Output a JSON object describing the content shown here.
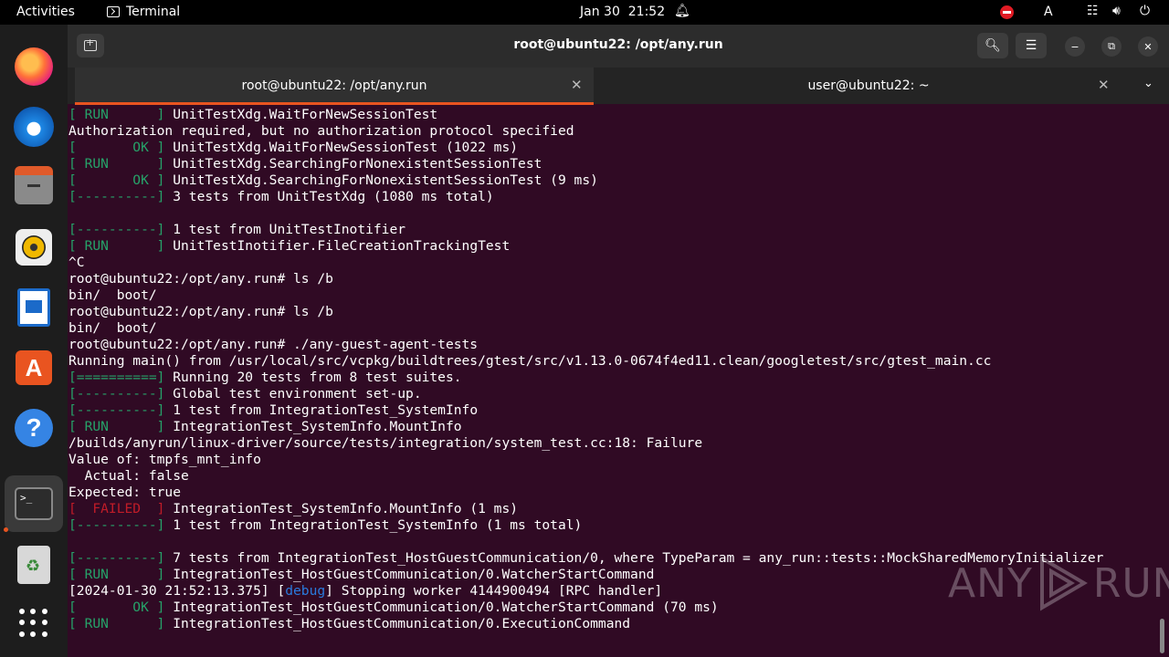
{
  "topbar": {
    "activities": "Activities",
    "app_name": "Terminal",
    "date": "Jan 30",
    "time": "21:52",
    "keyboard_layout": "A"
  },
  "dock": {
    "items": [
      "firefox",
      "thunderbird",
      "files",
      "rhythmbox",
      "libreoffice-writer",
      "app-center",
      "help",
      "terminal",
      "trash",
      "show-apps"
    ]
  },
  "window": {
    "title": "root@ubuntu22: /opt/any.run",
    "tabs": [
      {
        "label": "root@ubuntu22: /opt/any.run",
        "active": true
      },
      {
        "label": "user@ubuntu22: ~",
        "active": false
      }
    ]
  },
  "terminal": {
    "lines": [
      {
        "segs": [
          {
            "t": "[ RUN      ] ",
            "c": "g"
          },
          {
            "t": "UnitTestXdg.WaitForNewSessionTest"
          }
        ]
      },
      {
        "segs": [
          {
            "t": "Authorization required, but no authorization protocol specified"
          }
        ]
      },
      {
        "segs": [
          {
            "t": "[       OK ] ",
            "c": "g"
          },
          {
            "t": "UnitTestXdg.WaitForNewSessionTest (1022 ms)"
          }
        ]
      },
      {
        "segs": [
          {
            "t": "[ RUN      ] ",
            "c": "g"
          },
          {
            "t": "UnitTestXdg.SearchingForNonexistentSessionTest"
          }
        ]
      },
      {
        "segs": [
          {
            "t": "[       OK ] ",
            "c": "g"
          },
          {
            "t": "UnitTestXdg.SearchingForNonexistentSessionTest (9 ms)"
          }
        ]
      },
      {
        "segs": [
          {
            "t": "[----------] ",
            "c": "g"
          },
          {
            "t": "3 tests from UnitTestXdg (1080 ms total)"
          }
        ]
      },
      {
        "segs": []
      },
      {
        "segs": [
          {
            "t": "[----------] ",
            "c": "g"
          },
          {
            "t": "1 test from UnitTestInotifier"
          }
        ]
      },
      {
        "segs": [
          {
            "t": "[ RUN      ] ",
            "c": "g"
          },
          {
            "t": "UnitTestInotifier.FileCreationTrackingTest"
          }
        ]
      },
      {
        "segs": [
          {
            "t": "^C"
          }
        ]
      },
      {
        "segs": [
          {
            "t": "root@ubuntu22:/opt/any.run# ls /b"
          }
        ]
      },
      {
        "segs": [
          {
            "t": "bin/  boot/"
          }
        ]
      },
      {
        "segs": [
          {
            "t": "root@ubuntu22:/opt/any.run# ls /b"
          }
        ]
      },
      {
        "segs": [
          {
            "t": "bin/  boot/"
          }
        ]
      },
      {
        "segs": [
          {
            "t": "root@ubuntu22:/opt/any.run# ./any-guest-agent-tests"
          }
        ]
      },
      {
        "segs": [
          {
            "t": "Running main() from /usr/local/src/vcpkg/buildtrees/gtest/src/v1.13.0-0674f4ed11.clean/googletest/src/gtest_main.cc"
          }
        ]
      },
      {
        "segs": [
          {
            "t": "[==========] ",
            "c": "g"
          },
          {
            "t": "Running 20 tests from 8 test suites."
          }
        ]
      },
      {
        "segs": [
          {
            "t": "[----------] ",
            "c": "g"
          },
          {
            "t": "Global test environment set-up."
          }
        ]
      },
      {
        "segs": [
          {
            "t": "[----------] ",
            "c": "g"
          },
          {
            "t": "1 test from IntegrationTest_SystemInfo"
          }
        ]
      },
      {
        "segs": [
          {
            "t": "[ RUN      ] ",
            "c": "g"
          },
          {
            "t": "IntegrationTest_SystemInfo.MountInfo"
          }
        ]
      },
      {
        "segs": [
          {
            "t": "/builds/anyrun/linux-driver/source/tests/integration/system_test.cc:18: Failure"
          }
        ]
      },
      {
        "segs": [
          {
            "t": "Value of: tmpfs_mnt_info"
          }
        ]
      },
      {
        "segs": [
          {
            "t": "  Actual: false"
          }
        ]
      },
      {
        "segs": [
          {
            "t": "Expected: true"
          }
        ]
      },
      {
        "segs": [
          {
            "t": "[  FAILED  ] ",
            "c": "r"
          },
          {
            "t": "IntegrationTest_SystemInfo.MountInfo (1 ms)"
          }
        ]
      },
      {
        "segs": [
          {
            "t": "[----------] ",
            "c": "g"
          },
          {
            "t": "1 test from IntegrationTest_SystemInfo (1 ms total)"
          }
        ]
      },
      {
        "segs": []
      },
      {
        "segs": [
          {
            "t": "[----------] ",
            "c": "g"
          },
          {
            "t": "7 tests from IntegrationTest_HostGuestCommunication/0, where TypeParam = any_run::tests::MockSharedMemoryInitializer"
          }
        ]
      },
      {
        "segs": [
          {
            "t": "[ RUN      ] ",
            "c": "g"
          },
          {
            "t": "IntegrationTest_HostGuestCommunication/0.WatcherStartCommand"
          }
        ]
      },
      {
        "segs": [
          {
            "t": "[2024-01-30 21:52:13.375] ["
          },
          {
            "t": "debug",
            "c": "b"
          },
          {
            "t": "] Stopping worker 4144900494 [RPC handler]"
          }
        ]
      },
      {
        "segs": [
          {
            "t": "[       OK ] ",
            "c": "g"
          },
          {
            "t": "IntegrationTest_HostGuestCommunication/0.WatcherStartCommand (70 ms)"
          }
        ]
      },
      {
        "segs": [
          {
            "t": "[ RUN      ] ",
            "c": "g"
          },
          {
            "t": "IntegrationTest_HostGuestCommunication/0.ExecutionCommand"
          }
        ]
      }
    ]
  },
  "watermark": {
    "left": "ANY",
    "right": "RUN"
  }
}
